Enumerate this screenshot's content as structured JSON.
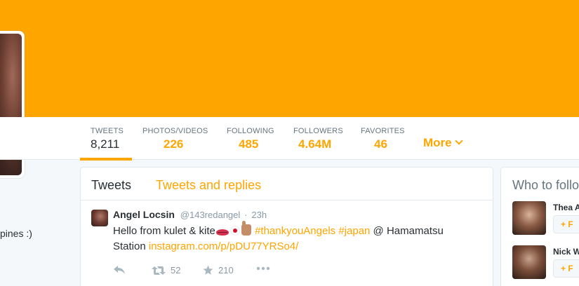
{
  "colors": {
    "accent": "#FFA500",
    "banner": "#FFA500",
    "text": "#292f33",
    "muted": "#66757f"
  },
  "profile_nav": {
    "stats": [
      {
        "label": "TWEETS",
        "value": "8,211"
      },
      {
        "label": "PHOTOS/VIDEOS",
        "value": "226"
      },
      {
        "label": "FOLLOWING",
        "value": "485"
      },
      {
        "label": "FOLLOWERS",
        "value": "4.64M"
      },
      {
        "label": "FAVORITES",
        "value": "46"
      }
    ],
    "more_label": "More",
    "more_icon": "chevron-down-icon"
  },
  "bio_fragment": "pines :)",
  "timeline": {
    "tabs": {
      "tweets": "Tweets",
      "replies": "Tweets and replies"
    },
    "tweet": {
      "name": "Angel Locsin",
      "handle": "@143redangel",
      "separator": "·",
      "time": "23h",
      "text_before": "Hello from kulet & kite",
      "emojis": [
        "lips-icon",
        "japan-flag-icon",
        "thumbs-up-icon"
      ],
      "hashtag1": "#thankyouAngels",
      "hashtag2": "#japan",
      "text_mid": "@ Hamamatsu",
      "text_line2": "Station",
      "link": "instagram.com/p/pDU77YRSo4/",
      "retweets": "52",
      "favorites": "210"
    }
  },
  "who_to_follow": {
    "title": "Who to follo",
    "suggestions": [
      {
        "name": "Thea A",
        "button": "+ F"
      },
      {
        "name": "Nick W",
        "button": "+ F"
      }
    ]
  }
}
